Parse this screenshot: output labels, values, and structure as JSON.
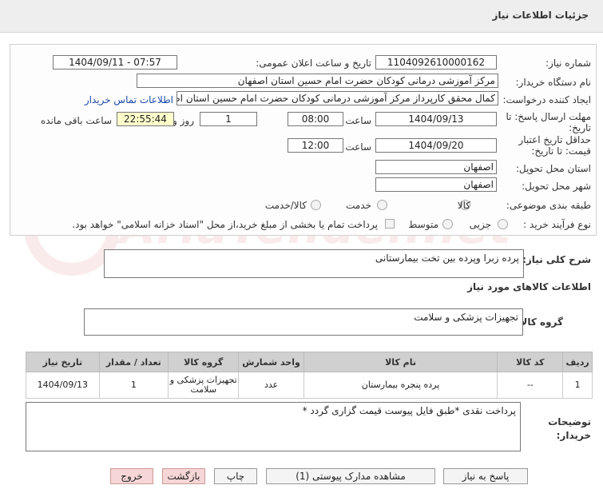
{
  "header": {
    "title": "جزئیات اطلاعات نیاز"
  },
  "watermark": {
    "text": "AriaTender.net"
  },
  "form": {
    "need_number_label": "شماره نیاز:",
    "need_number": "1104092610000162",
    "announce_label": "تاریخ و ساعت اعلان عمومی:",
    "announce_value": "1404/09/11 - 07:57",
    "buyer_org_label": "نام دستگاه خریدار:",
    "buyer_org": "مرکز آموزشی درمانی کودکان حضرت امام حسین استان اصفهان",
    "requester_label": "ایجاد کننده درخواست:",
    "requester": "کمال محقق کارپرداز مرکز آموزشی درمانی کودکان حضرت امام حسین استان اصفهان",
    "contact_link": "اطلاعات تماس خریدار",
    "deadline_label_1": "مهلت ارسال پاسخ: تا",
    "deadline_label_2": "تاریخ:",
    "deadline_date": "1404/09/13",
    "time_label": "ساعت",
    "deadline_time": "08:00",
    "days_value": "1",
    "days_label": "روز و",
    "remaining_time": "22:55:44",
    "remaining_label": "ساعت باقی مانده",
    "validity_label_1": "حداقل تاریخ اعتبار",
    "validity_label_2": "قیمت: تا تاریخ:",
    "validity_date": "1404/09/20",
    "validity_time": "12:00",
    "province_label": "استان محل تحویل:",
    "province": "اصفهان",
    "city_label": "شهر محل تحویل:",
    "city": "اصفهان",
    "category_label": "طبقه بندی موضوعی:",
    "category_options": [
      "کالا",
      "خدمت",
      "کالا/خدمت"
    ],
    "process_label": "نوع فرآیند خرید :",
    "process_options": [
      "جزیی",
      "متوسط"
    ],
    "payment_note": "پرداخت تمام یا بخشی از مبلغ خرید،از محل \"اسناد خزانه اسلامی\" خواهد بود."
  },
  "summary": {
    "label": "شرح کلی نیاز:",
    "text": "پرده زبرا وپرده بین تخت بیمارستانی"
  },
  "goods": {
    "section_title": "اطلاعات کالاهای مورد نیاز",
    "group_label": "گروه کالا:",
    "group_value": "تجهیزات پزشکی و سلامت"
  },
  "table": {
    "headers": [
      "ردیف",
      "کد کالا",
      "نام کالا",
      "واحد شمارش",
      "گروه کالا",
      "تعداد / مقدار",
      "تاریخ نیاز"
    ],
    "rows": [
      [
        "1",
        "--",
        "پرده پنجره بیمارستان",
        "عدد",
        "تجهیزات پزشکی و سلامت",
        "1",
        "1404/09/13"
      ]
    ]
  },
  "buyer_notes": {
    "label_1": "توضیحات",
    "label_2": "خریدار:",
    "text": "پرداخت نقدی *طبق فایل پیوست قیمت گزاری گردد *"
  },
  "buttons": {
    "reply": "پاسخ به نیاز",
    "attachments": "مشاهده مدارک پیوستی (1)",
    "print": "چاپ",
    "back": "بازگشت",
    "exit": "خروج"
  }
}
